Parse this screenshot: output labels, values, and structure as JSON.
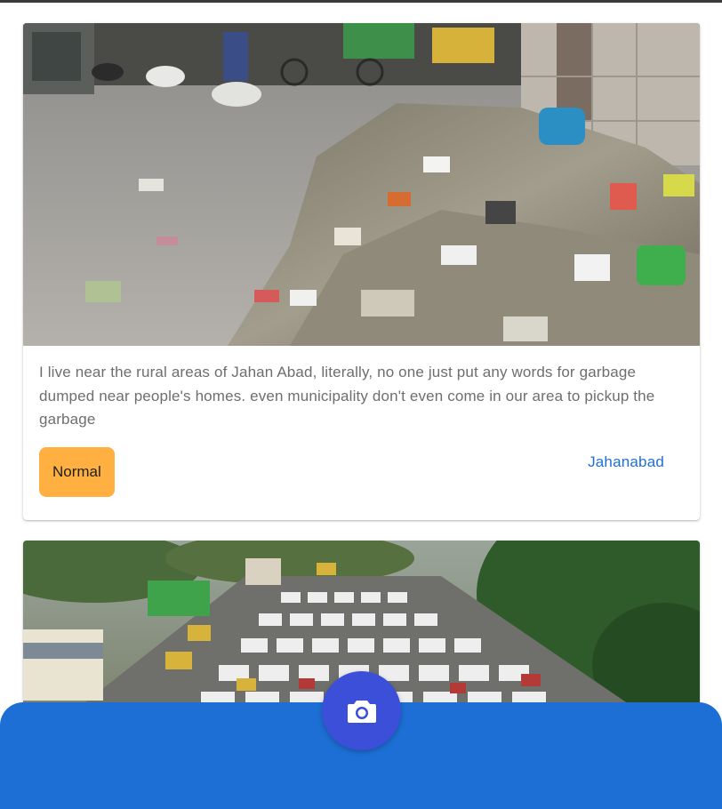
{
  "feed": {
    "posts": [
      {
        "image_alt": "Garbage dumped on a street",
        "description": "I live near the rural areas of Jahan Abad, literally, no one just put any words for garbage dumped near people's homes. even municipality don't even come in our area to pickup the garbage",
        "severity": "Normal",
        "location": "Jahanabad"
      },
      {
        "image_alt": "Heavy traffic jam on a road"
      }
    ]
  },
  "bottom_nav": {
    "camera_icon": "camera-icon"
  },
  "colors": {
    "severity_normal": "#ffb040",
    "location_link": "#1e6fd6",
    "bottom_bar": "#1d6fd5",
    "fab": "#3b4fd8"
  }
}
